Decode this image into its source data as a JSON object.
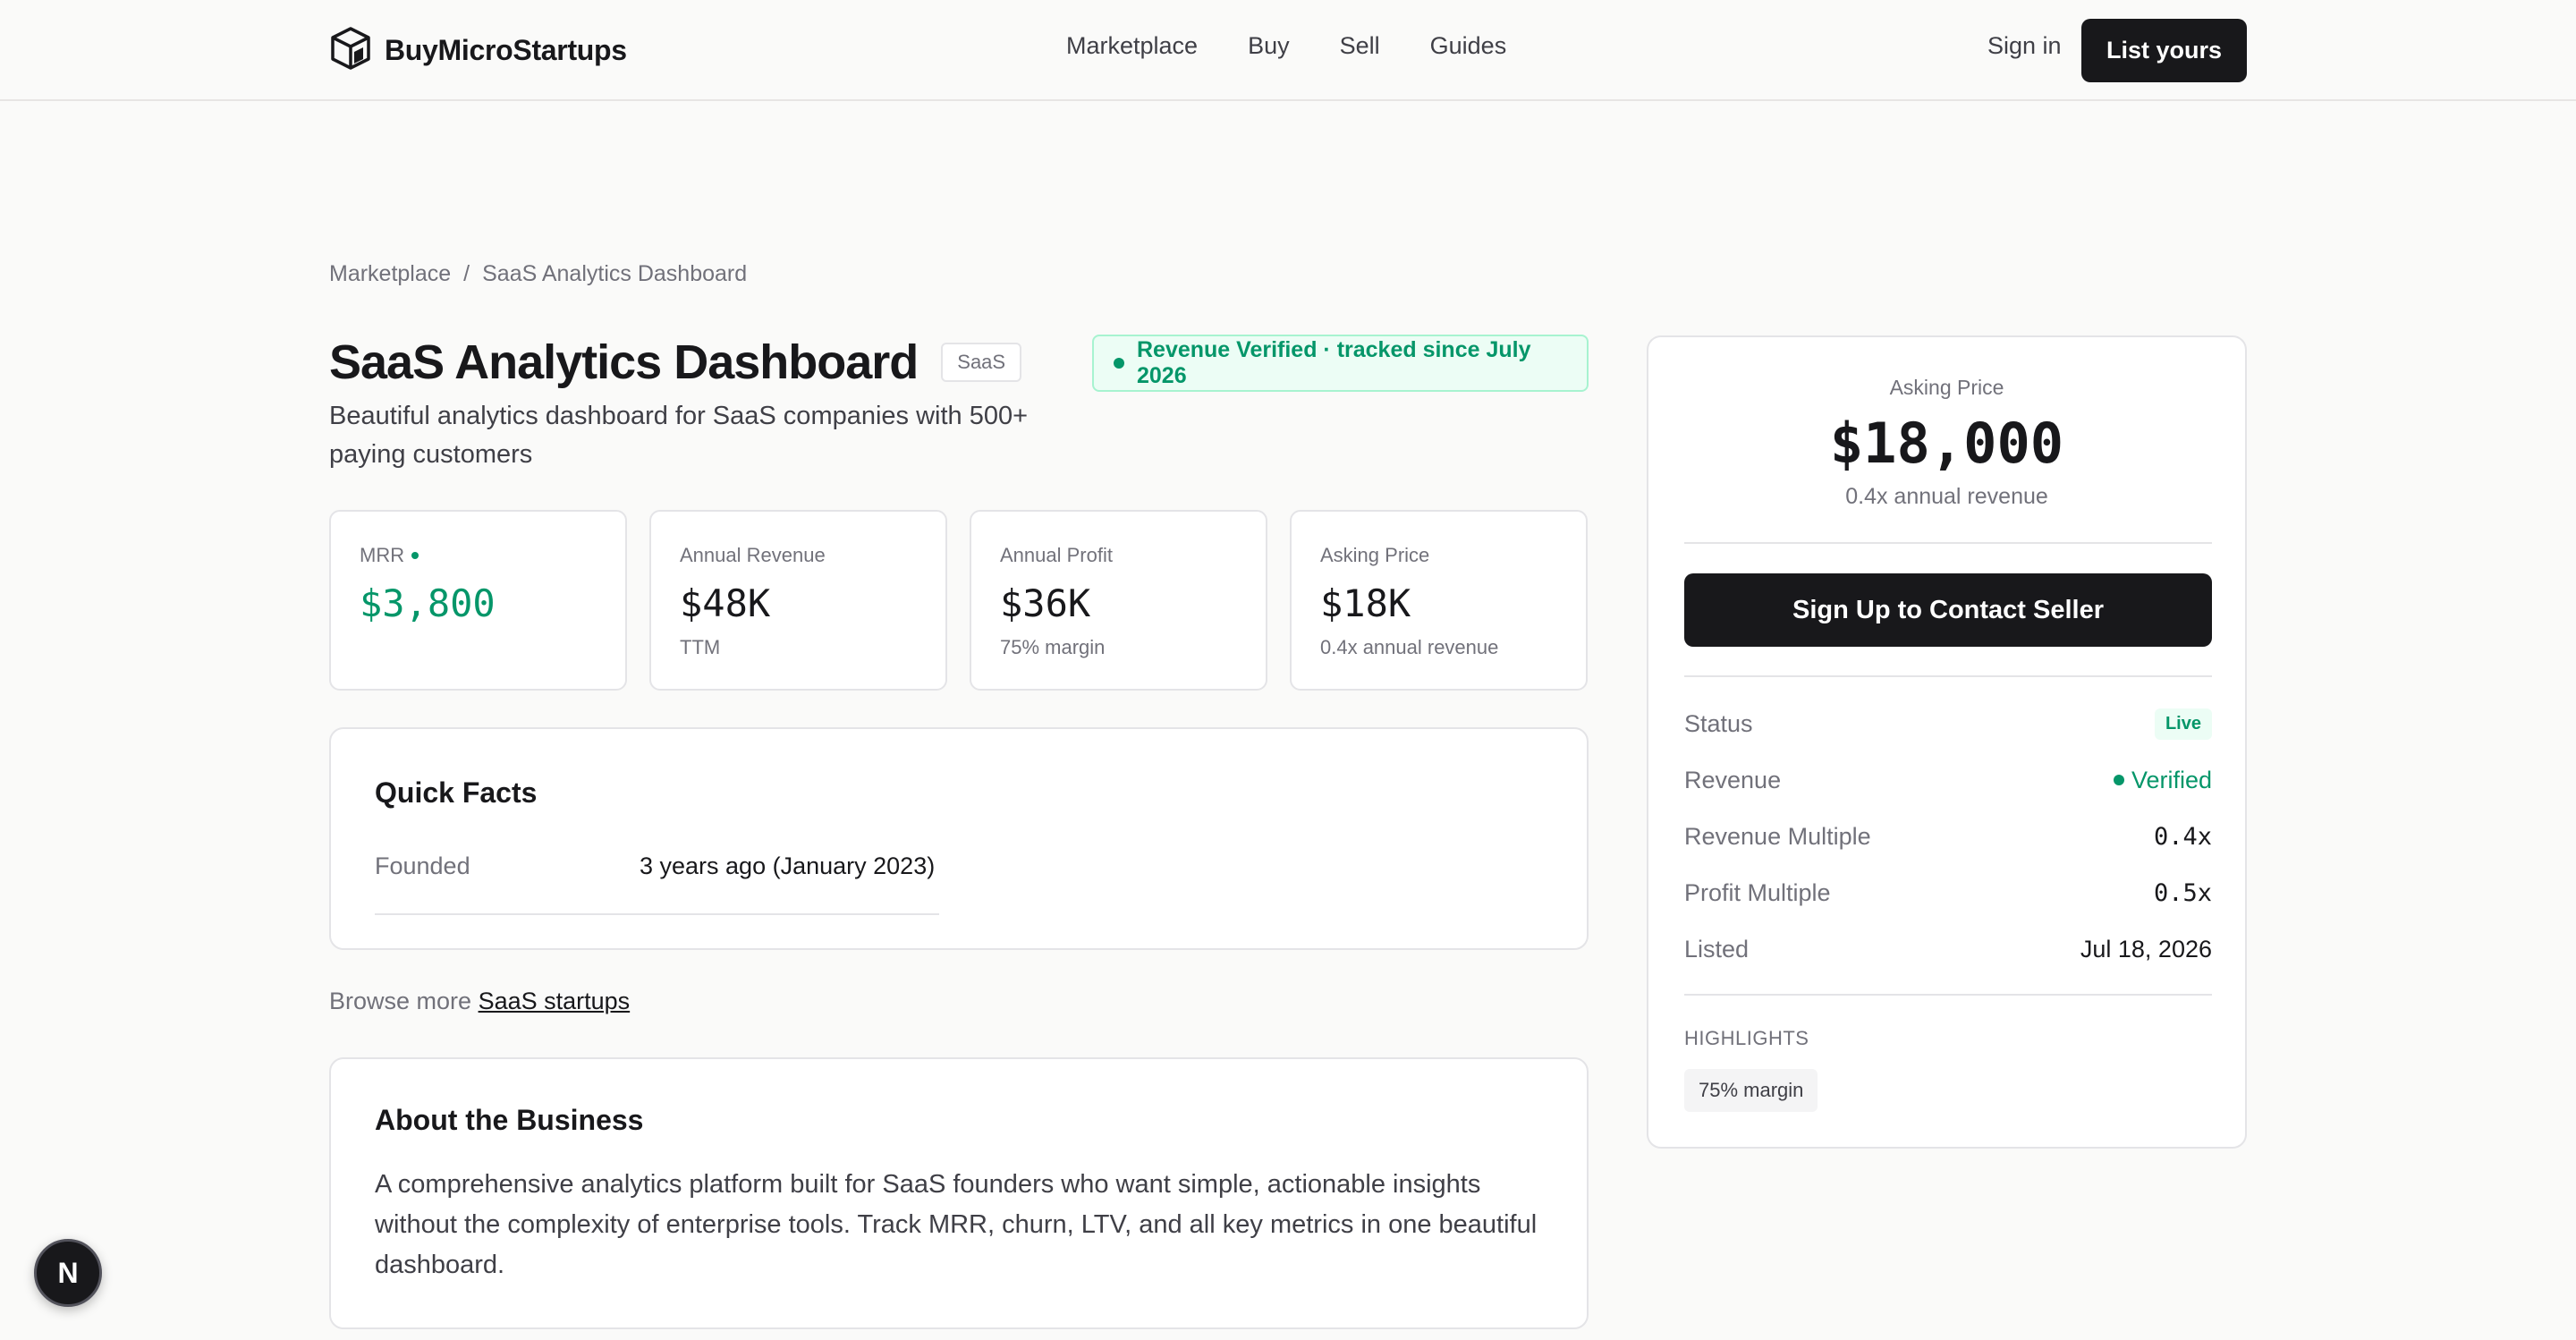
{
  "header": {
    "brand": "BuyMicroStartups",
    "nav": [
      "Marketplace",
      "Buy",
      "Sell",
      "Guides"
    ],
    "sign_in": "Sign in",
    "cta": "List yours"
  },
  "breadcrumb": {
    "root": "Marketplace",
    "separator": "/",
    "current": "SaaS Analytics Dashboard"
  },
  "listing": {
    "title": "SaaS Analytics Dashboard",
    "tag": "SaaS",
    "verified_banner": "Revenue Verified · tracked since July 2026",
    "subtitle": "Beautiful analytics dashboard for SaaS companies with 500+ paying customers"
  },
  "metrics": [
    {
      "label": "MRR",
      "value": "$3,800",
      "sub": ""
    },
    {
      "label": "Annual Revenue",
      "value": "$48K",
      "sub": "TTM"
    },
    {
      "label": "Annual Profit",
      "value": "$36K",
      "sub": "75% margin"
    },
    {
      "label": "Asking Price",
      "value": "$18K",
      "sub": "0.4x annual revenue"
    }
  ],
  "quick_facts": {
    "title": "Quick Facts",
    "rows": [
      {
        "label": "Founded",
        "value": "3 years ago (January 2023)"
      }
    ]
  },
  "browse": {
    "prefix": "Browse more",
    "link": "SaaS startups"
  },
  "about": {
    "title": "About the Business",
    "text": "A comprehensive analytics platform built for SaaS founders who want simple, actionable insights without the complexity of enterprise tools. Track MRR, churn, LTV, and all key metrics in one beautiful dashboard."
  },
  "sidebar": {
    "asking_label": "Asking Price",
    "asking_value": "$18,000",
    "asking_sub": "0.4x annual revenue",
    "contact_button": "Sign Up to Contact Seller",
    "rows": [
      {
        "label": "Status",
        "value": "Live"
      },
      {
        "label": "Revenue",
        "value": "Verified"
      },
      {
        "label": "Revenue Multiple",
        "value": "0.4x"
      },
      {
        "label": "Profit Multiple",
        "value": "0.5x"
      },
      {
        "label": "Listed",
        "value": "Jul 18, 2026"
      }
    ],
    "highlights_label": "HIGHLIGHTS",
    "highlights": [
      "75% margin"
    ]
  },
  "floating_badge": "N",
  "colors": {
    "accent_green": "#059669",
    "dark": "#18181b",
    "background": "#fafaf9"
  },
  "icons": {
    "logo": "cube-icon",
    "verified": "green-dot-icon"
  }
}
